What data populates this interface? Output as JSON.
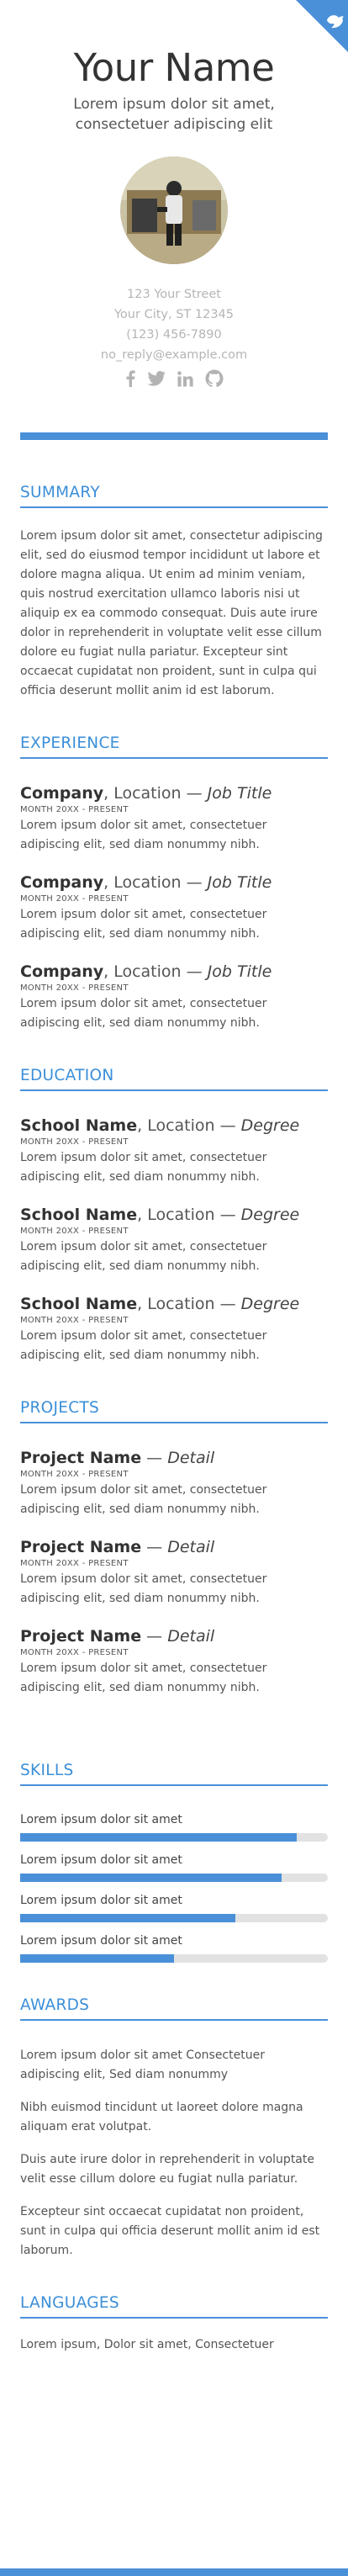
{
  "header": {
    "name": "Your Name",
    "tagline": "Lorem ipsum dolor sit amet, consectetuer adipiscing elit",
    "contact": [
      "123 Your Street",
      "Your City, ST 12345",
      "(123) 456-7890",
      "no_reply@example.com"
    ],
    "social_icons": [
      "facebook-icon",
      "twitter-icon",
      "linkedin-icon",
      "github-icon"
    ]
  },
  "colors": {
    "accent": "#4a90d9",
    "track": "#e2e2e2"
  },
  "summary": {
    "title": "SUMMARY",
    "text": "Lorem ipsum dolor sit amet, consectetur adipiscing elit, sed do eiusmod tempor incididunt ut labore et dolore magna aliqua. Ut enim ad minim veniam, quis nostrud exercitation ullamco laboris nisi ut aliquip ex ea commodo consequat. Duis aute irure dolor in reprehenderit in voluptate velit esse cillum dolore eu fugiat nulla pariatur. Excepteur sint occaecat cupidatat non proident, sunt in culpa qui officia deserunt mollit anim id est laborum."
  },
  "experience": {
    "title": "EXPERIENCE",
    "items": [
      {
        "org": "Company",
        "location": ", Location — ",
        "role": "Job Title",
        "date": "MONTH 20XX - PRESENT",
        "desc": "Lorem ipsum dolor sit amet, consectetuer adipiscing elit, sed diam nonummy nibh."
      },
      {
        "org": "Company",
        "location": ", Location — ",
        "role": "Job Title",
        "date": "MONTH 20XX - PRESENT",
        "desc": "Lorem ipsum dolor sit amet, consectetuer adipiscing elit, sed diam nonummy nibh."
      },
      {
        "org": "Company",
        "location": ", Location — ",
        "role": "Job Title",
        "date": "MONTH 20XX - PRESENT",
        "desc": "Lorem ipsum dolor sit amet, consectetuer adipiscing elit, sed diam nonummy nibh."
      }
    ]
  },
  "education": {
    "title": "EDUCATION",
    "items": [
      {
        "org": "School Name",
        "location": ", Location — ",
        "role": "Degree",
        "date": "MONTH 20XX - PRESENT",
        "desc": "Lorem ipsum dolor sit amet, consectetuer adipiscing elit, sed diam nonummy nibh."
      },
      {
        "org": "School Name",
        "location": ", Location — ",
        "role": "Degree",
        "date": "MONTH 20XX - PRESENT",
        "desc": "Lorem ipsum dolor sit amet, consectetuer adipiscing elit, sed diam nonummy nibh."
      },
      {
        "org": "School Name",
        "location": ", Location — ",
        "role": "Degree",
        "date": "MONTH 20XX - PRESENT",
        "desc": "Lorem ipsum dolor sit amet, consectetuer adipiscing elit, sed diam nonummy nibh."
      }
    ]
  },
  "projects": {
    "title": "PROJECTS",
    "items": [
      {
        "org": "Project Name",
        "location": " — ",
        "role": "Detail",
        "date": "MONTH 20XX - PRESENT",
        "desc": "Lorem ipsum dolor sit amet, consectetuer adipiscing elit, sed diam nonummy nibh."
      },
      {
        "org": "Project Name",
        "location": " — ",
        "role": "Detail",
        "date": "MONTH 20XX - PRESENT",
        "desc": "Lorem ipsum dolor sit amet, consectetuer adipiscing elit, sed diam nonummy nibh."
      },
      {
        "org": "Project Name",
        "location": " — ",
        "role": "Detail",
        "date": "MONTH 20XX - PRESENT",
        "desc": "Lorem ipsum dolor sit amet, consectetuer adipiscing elit, sed diam nonummy nibh."
      }
    ]
  },
  "skills": {
    "title": "SKILLS",
    "items": [
      {
        "label": "Lorem ipsum dolor sit amet",
        "level": 0.9
      },
      {
        "label": "Lorem ipsum dolor sit amet",
        "level": 0.85
      },
      {
        "label": "Lorem ipsum dolor sit amet",
        "level": 0.7
      },
      {
        "label": "Lorem ipsum dolor sit amet",
        "level": 0.5
      }
    ]
  },
  "awards": {
    "title": "AWARDS",
    "items": [
      "Lorem ipsum dolor sit amet Consectetuer adipiscing elit, Sed diam nonummy",
      "Nibh euismod tincidunt ut laoreet dolore magna aliquam erat volutpat.",
      "Duis aute irure dolor in reprehenderit in voluptate velit esse cillum dolore eu fugiat nulla pariatur.",
      "Excepteur sint occaecat cupidatat non proident, sunt in culpa qui officia deserunt mollit anim id est laborum."
    ]
  },
  "languages": {
    "title": "LANGUAGES",
    "text": "Lorem ipsum, Dolor sit amet, Consectetuer"
  }
}
